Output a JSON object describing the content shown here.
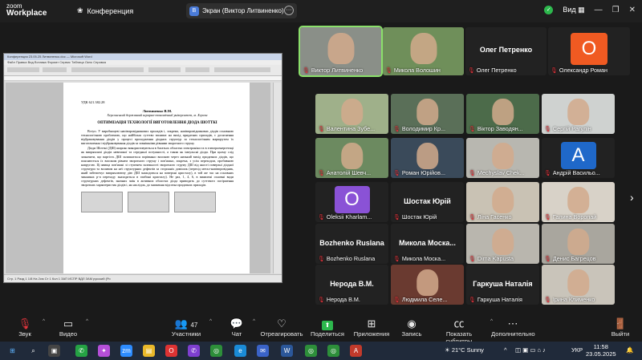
{
  "topbar": {
    "logo_top": "zoom",
    "logo_bottom": "Workplace",
    "meeting_label": "Конференция",
    "share_label": "Экран (Виктор Литвиненко)",
    "share_badge": "В",
    "view_label": "Вид"
  },
  "document": {
    "window_title": "Конференция 23.05.25 Литвиненко.doc — Microsoft Word",
    "menu": "Файл  Правка  Вид  Вставка  Формат  Сервис  Таблица  Окно  Справка",
    "udk": "УДК 621.382.28",
    "author": "Литвиненко В.М.",
    "affiliation": "Херсонський державний аграрно-економічний університет, м. Херсон",
    "title": "ОПТИМІЗАЦІЯ ТЕХНОЛОГІЇ ВИГОТОВЛЕННЯ ДІОДА ШОТТКІ",
    "para1": "Вступ. У виробництві напівпровідникових приладів і, зокрема, напівпровідникових діодів основною технологічною проблемою, що найбільш суттєво впливає на вихід придатних приладів, є досягнення відбраковування діодів у процесі проходження діодних структур за технологічним маршрутом їх виготовлення і відбраковування діодів за зовнішніми рівнями зворотного струму.",
    "para2": "Діоди Шотткі (ДШ) широко використовуються в багатьох областях електроніки та в електроенергетиці як випрямлячі діодів невеликої та середньої потужності, а також як імпульсні діоди. При цьому слід зазначити, що вартість ДШ залишається порівняно високою через низький вихід придатних діодів, що пояснюється їх високим рівнем зворотного струму і пов'язано, зокрема, з усім переходом, пробивною напругою. Ці явища пов'язані зі ступенем залежності зворотного струму ДШ від якості поверхні діодної структури та впливом на неї структурних дефектів за сторонніх домішок (перехід метал-напівпровідник, який забезпечує випрямлюючу дію ДШ знаходиться на поверхні кристалу), в той же час на основних чинниках р-п переходу знаходиться в глибині кристалу). Не раз, 1, 4, 6, в виявлені основні види структурних дефектів, значних змін в активних областях діода приводить до суттєвого погіршення зворотних характеристик діодів і, як наслідок, до зниження відсотка придатних приладів.",
    "status": "Стр. 1    Разд 1    1/8    На 2см    Ст 1    Кол 1    ЗАП  ИСПР  ВДЛ  ЗАМ  русский (Ро"
  },
  "tiles": [
    {
      "name": "Виктор Литвиненко",
      "kind": "video",
      "bg": "#8a8f88"
    },
    {
      "name": "Микола Волошин",
      "kind": "video",
      "bg": "#6f8f5a"
    },
    {
      "name": "Олег Петренко",
      "kind": "text",
      "center": "Олег Петренко"
    },
    {
      "name": "Олександр Роман",
      "kind": "avatar",
      "letter": "О",
      "color": "#f05a22"
    },
    {
      "name": "Валентина Зубе...",
      "kind": "video",
      "bg": "#9fb08a"
    },
    {
      "name": "Володимир Кр...",
      "kind": "video",
      "bg": "#5a6f58"
    },
    {
      "name": "Віктор Заводян...",
      "kind": "video",
      "bg": "#4c6b4a"
    },
    {
      "name": "Сергій Рагулін",
      "kind": "video",
      "bg": "#cfd2d0"
    },
    {
      "name": "Анатолій Шевч...",
      "kind": "video",
      "bg": "#6c8a60"
    },
    {
      "name": "Роман Юрійов...",
      "kind": "video",
      "bg": "#3a4a5a"
    },
    {
      "name": "Mechyslav Chek...",
      "kind": "video",
      "bg": "#b8b7b0"
    },
    {
      "name": "Андрій Васильо...",
      "kind": "avatar",
      "letter": "A",
      "color": "#1f68c9"
    },
    {
      "name": "Oleksii Kharlam...",
      "kind": "avatar",
      "letter": "O",
      "color": "#8a52d6"
    },
    {
      "name": "Шостак Юрій",
      "kind": "text",
      "center": "Шостак Юрій"
    },
    {
      "name": "Ліна Гасенко",
      "kind": "video",
      "bg": "#c9c2b4"
    },
    {
      "name": "Галина Воропай",
      "kind": "video",
      "bg": "#d8d2c8"
    },
    {
      "name": "Bozhenko Ruslana",
      "kind": "text",
      "center": "Bozhenko Ruslana"
    },
    {
      "name": "Микола Моска...",
      "kind": "text",
      "center": "Микола  Моска..."
    },
    {
      "name": "Dima Kapusta",
      "kind": "video",
      "bg": "#b9b6ae"
    },
    {
      "name": "Денис Багрецов",
      "kind": "video",
      "bg": "#a9a69e"
    },
    {
      "name": "Нерода В.М.",
      "kind": "text",
      "center": "Нерода В.М."
    },
    {
      "name": "Людмила Селе...",
      "kind": "video",
      "bg": "#6a3a30"
    },
    {
      "name": "Гаркуша Наталія",
      "kind": "text",
      "center": "Гаркуша Наталія"
    },
    {
      "name": "Ірина Клименко",
      "kind": "video",
      "bg": "#c9c4ba"
    }
  ],
  "toolbar": {
    "audio": "Звук",
    "video": "Видео",
    "participants": "Участники",
    "participants_count": "47",
    "chat": "Чат",
    "react": "Отреагировать",
    "share": "Поделиться",
    "apps": "Приложения",
    "record": "Запись",
    "captions": "Показать субтитры",
    "more": "Дополнительно",
    "leave": "Выйти"
  },
  "taskbar": {
    "weather": "21°C  Sunny",
    "lang": "УКР",
    "time": "11:58",
    "date": "23.05.2025"
  }
}
